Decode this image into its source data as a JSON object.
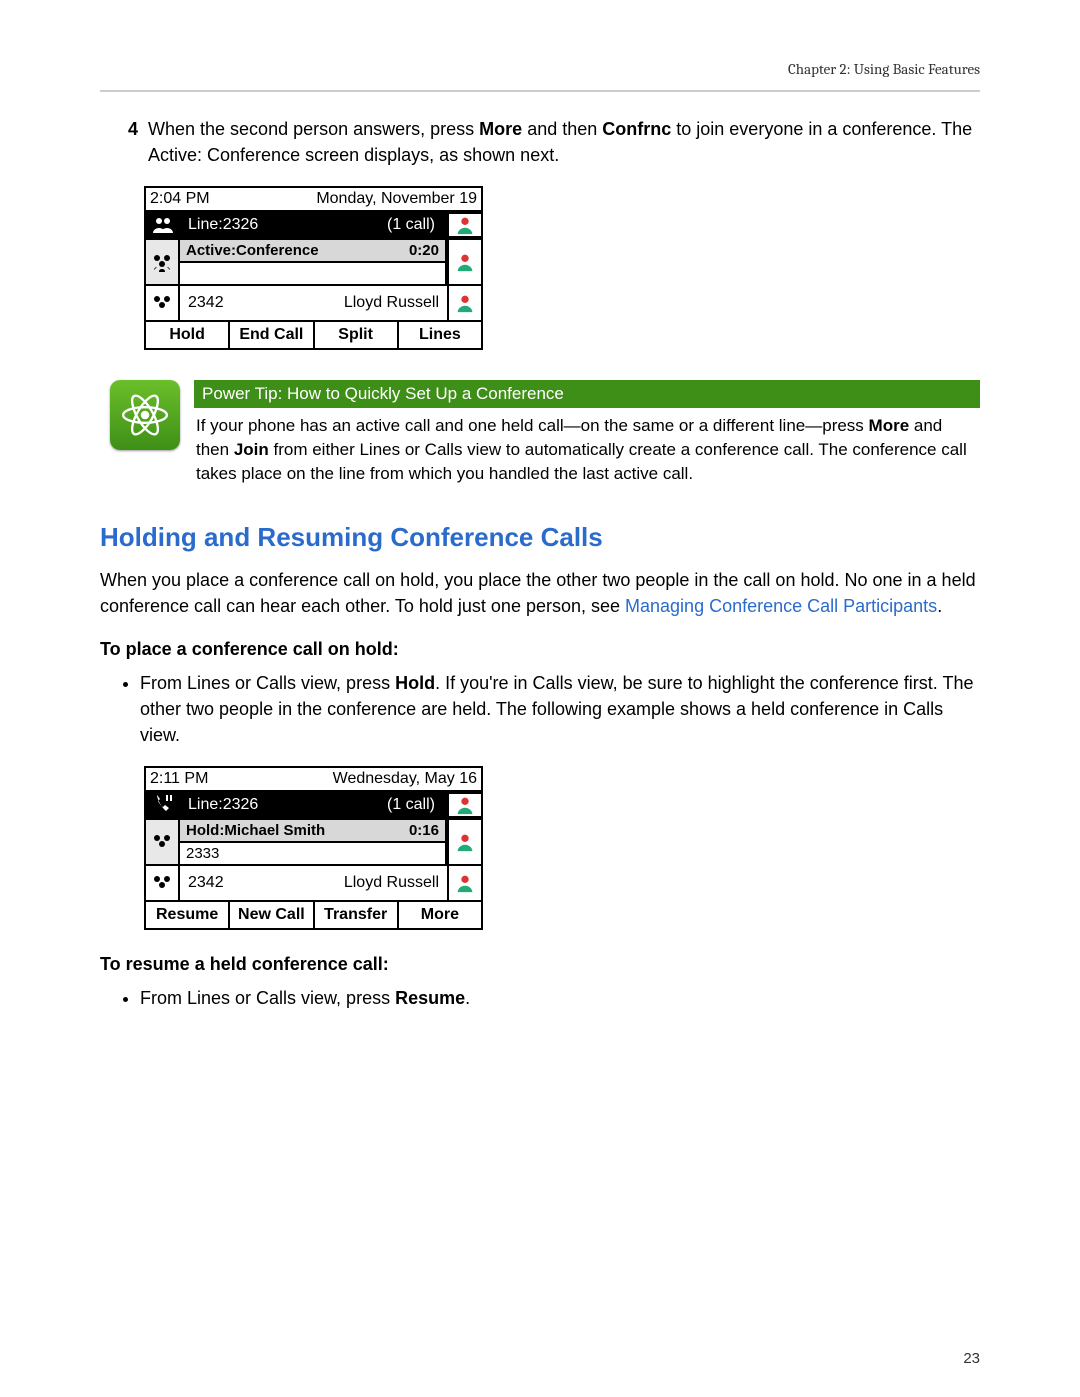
{
  "header": {
    "chapter": "Chapter 2: Using Basic Features"
  },
  "step4": {
    "number": "4",
    "text_a": "When the second person answers, press ",
    "more": "More",
    "text_b": " and then ",
    "confrnc": "Confrnc",
    "text_c": " to join everyone in a conference. The Active: Conference screen displays, as shown next."
  },
  "phone1": {
    "time": "2:04 PM",
    "date": "Monday, November 19",
    "line": "Line:2326",
    "calls": "(1 call)",
    "status": "Active:Conference",
    "duration": "0:20",
    "party_num": "2342",
    "party_name": "Lloyd Russell",
    "softkeys": [
      "Hold",
      "End Call",
      "Split",
      "Lines"
    ]
  },
  "tip": {
    "title": "Power Tip: How to Quickly Set Up a Conference",
    "body_a": "If your phone has an active call and one held call—on the same or a different line—press ",
    "more": "More",
    "body_b": " and then ",
    "join": "Join",
    "body_c": " from either Lines or Calls view to automatically create a conference call. The conference call takes place on the line from which you handled the last active call."
  },
  "section": {
    "title": "Holding and Resuming Conference Calls",
    "para_a": "When you place a conference call on hold, you place the other two people in the call on hold. No one in a held conference call can hear each other. To hold just one person, see ",
    "link": "Managing Conference Call Participants",
    "para_b": "."
  },
  "hold_heading": "To place a conference call on hold:",
  "hold_bullet": {
    "a": "From Lines or Calls view, press ",
    "hold": "Hold",
    "b": ". If you're in Calls view, be sure to highlight the conference first. The other two people in the conference are held. The following example shows a held conference in Calls view."
  },
  "phone2": {
    "time": "2:11 PM",
    "date": "Wednesday, May 16",
    "line": "Line:2326",
    "calls": "(1 call)",
    "status": "Hold:Michael Smith",
    "ext": "2333",
    "duration": "0:16",
    "party_num": "2342",
    "party_name": "Lloyd Russell",
    "softkeys": [
      "Resume",
      "New Call",
      "Transfer",
      "More"
    ]
  },
  "resume_heading": "To resume a held conference call:",
  "resume_bullet": {
    "a": "From Lines or Calls view, press ",
    "resume": "Resume",
    "b": "."
  },
  "page_number": "23"
}
